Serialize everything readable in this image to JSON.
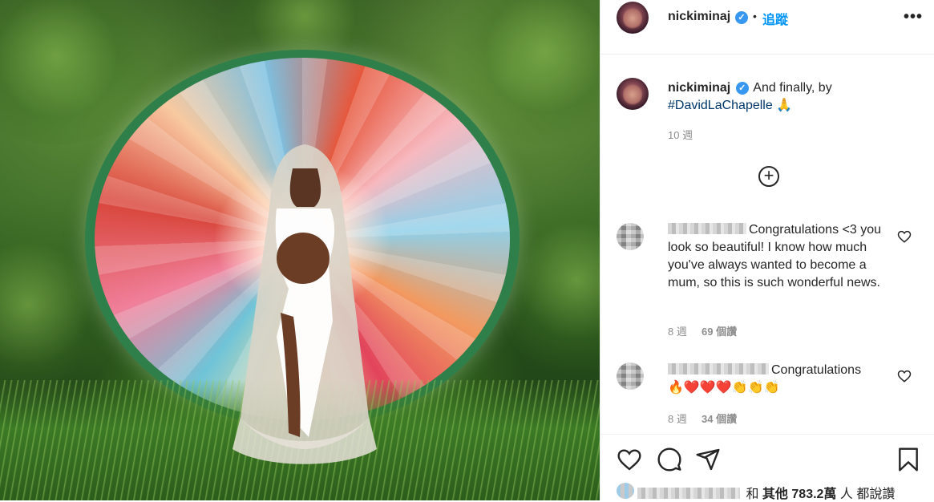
{
  "post": {
    "username": "nickiminaj",
    "follow_label": "追蹤",
    "separator": "•",
    "more_label": "•••",
    "caption": "And finally, by",
    "hashtag": "#DavidLaChapelle",
    "emoji": "🙏",
    "age": "10 週",
    "load_more_icon": "plus-circle-icon"
  },
  "comments": [
    {
      "text": "Congratulations <3 you look so beautiful! I know how much you've always wanted to become a mum, so this is such wonderful news.",
      "age": "8 週",
      "likes": "69 個讚"
    },
    {
      "text": "Congratulations",
      "emojis": "🔥❤️❤️❤️👏👏👏",
      "age": "8 週",
      "likes": "34 個讚"
    }
  ],
  "likes_summary": {
    "prefix": "和",
    "others": "其他",
    "count": "783.2萬",
    "suffix": "人 都說讚"
  },
  "icons": [
    "heart-icon",
    "comment-icon",
    "share-icon",
    "bookmark-icon",
    "verified-badge-icon"
  ],
  "colors": {
    "follow": "#0095f6",
    "hashtag": "#00376b",
    "verified": "#3897f0",
    "meta": "#8e8e8e"
  }
}
